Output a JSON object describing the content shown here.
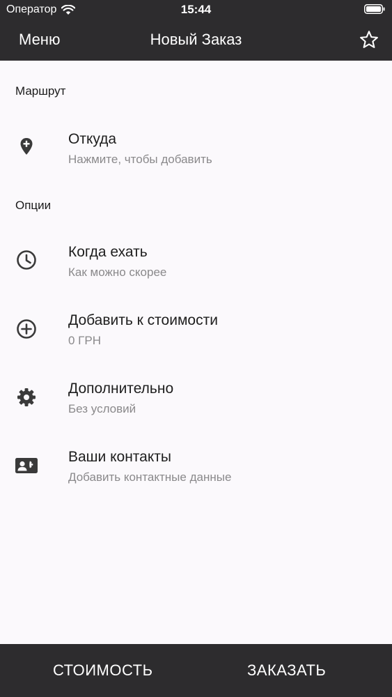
{
  "status_bar": {
    "carrier": "Оператор",
    "time": "15:44"
  },
  "nav_bar": {
    "menu_label": "Меню",
    "title": "Новый Заказ",
    "favorite_icon": "star-outline-icon"
  },
  "sections": {
    "route_header": "Маршрут",
    "options_header": "Опции"
  },
  "route": {
    "from": {
      "icon": "location-add-icon",
      "title": "Откуда",
      "subtitle": "Нажмите, чтобы добавить"
    }
  },
  "options": [
    {
      "icon": "clock-icon",
      "title": "Когда ехать",
      "subtitle": "Как можно скорее"
    },
    {
      "icon": "add-circle-icon",
      "title": "Добавить к стоимости",
      "subtitle": "0 ГРН"
    },
    {
      "icon": "gear-icon",
      "title": "Дополнительно",
      "subtitle": "Без условий"
    },
    {
      "icon": "contact-card-icon",
      "title": "Ваши контакты",
      "subtitle": "Добавить контактные данные"
    }
  ],
  "bottom_bar": {
    "cost_label": "СТОИМОСТЬ",
    "order_label": "ЗАКАЗАТЬ"
  },
  "colors": {
    "bar_background": "#2d2c2e",
    "page_background": "#fbf9fc",
    "icon_color": "#3a3a3a",
    "subtitle_color": "#8a898b"
  }
}
